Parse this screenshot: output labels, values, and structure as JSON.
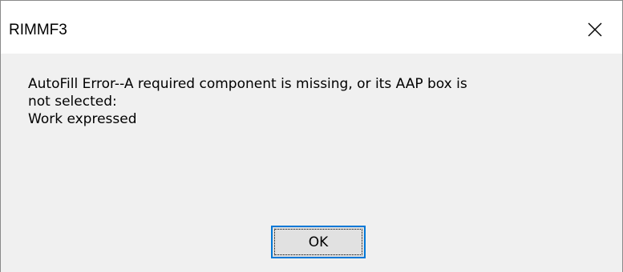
{
  "window": {
    "title": "RIMMF3"
  },
  "titlebar": {
    "close_icon": "close-icon"
  },
  "message": {
    "lines": [
      "AutoFill Error--A required component is missing, or its AAP box is",
      "not selected:",
      "Work expressed"
    ]
  },
  "buttons": {
    "ok_label": "OK"
  },
  "colors": {
    "focus_border": "#0078d7",
    "button_bg": "#e1e1e1",
    "dialog_bg": "#f0f0f0",
    "titlebar_bg": "#ffffff"
  }
}
